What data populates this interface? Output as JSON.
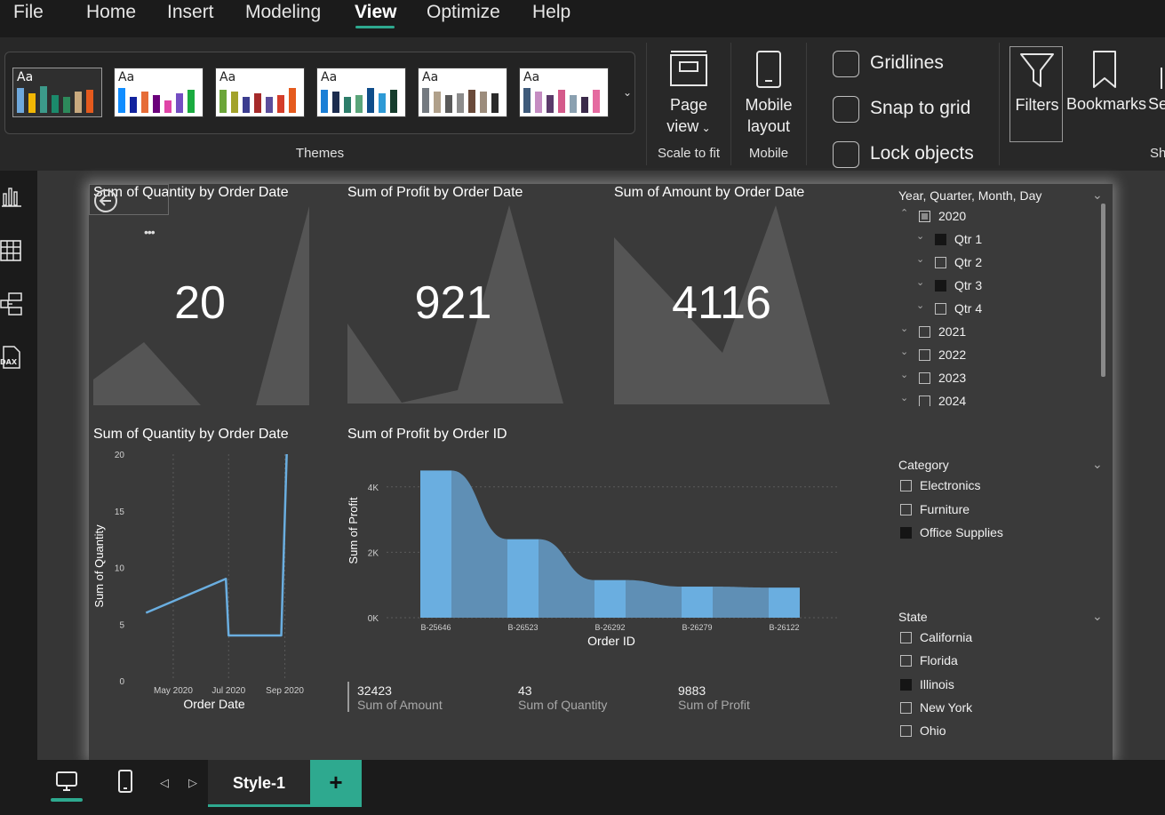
{
  "menubar": {
    "items": [
      "File",
      "Home",
      "Insert",
      "Modeling",
      "View",
      "Optimize",
      "Help"
    ],
    "active": "View"
  },
  "ribbon": {
    "themes_label": "Themes",
    "themes": [
      {
        "aa": "Aa",
        "colors": [
          "#6ea8dc",
          "#f2b705",
          "#3c9a8a",
          "#1b8a6b",
          "#2d8a5b",
          "#c8a97e",
          "#e55a1d"
        ]
      },
      {
        "aa": "Aa",
        "colors": [
          "#118dff",
          "#12239e",
          "#e66c37",
          "#6b007b",
          "#e044a7",
          "#744ec2",
          "#1aab40"
        ]
      },
      {
        "aa": "Aa",
        "colors": [
          "#6ba539",
          "#a2a22b",
          "#3c3d8f",
          "#a52a2a",
          "#5b4d9b",
          "#d43d2a",
          "#e55a1d"
        ]
      },
      {
        "aa": "Aa",
        "colors": [
          "#1b7fd6",
          "#1c2c4e",
          "#2d7d6a",
          "#5aa57a",
          "#0f4d8a",
          "#2e9ad6",
          "#163d2d"
        ]
      },
      {
        "aa": "Aa",
        "colors": [
          "#747a80",
          "#b0a08a",
          "#5a5a5a",
          "#8c8c8c",
          "#6a4a3a",
          "#9c8c7c",
          "#2a2a2a"
        ]
      },
      {
        "aa": "Aa",
        "colors": [
          "#3e5a7a",
          "#c58cc2",
          "#5a3a6a",
          "#d45a8a",
          "#8aa0b0",
          "#3a2a4a",
          "#e56aa0"
        ]
      }
    ],
    "page_view": {
      "line1": "Page",
      "line2": "view",
      "group": "Scale to fit"
    },
    "mobile_layout": {
      "line1": "Mobile",
      "line2": "layout",
      "group": "Mobile"
    },
    "checkboxes": [
      "Gridlines",
      "Snap to grid",
      "Lock objects"
    ],
    "filters": "Filters",
    "bookmarks": "Bookmarks",
    "selection_partial": "Se",
    "show_partial": "Sh"
  },
  "cards": [
    {
      "title": "Sum of Quantity by Order Date",
      "value": "20"
    },
    {
      "title": "Sum of Profit by Order Date",
      "value": "921"
    },
    {
      "title": "Sum of Amount by Order Date",
      "value": "4116"
    }
  ],
  "line_chart": {
    "title": "Sum of Quantity by Order Date",
    "xlabel": "Order Date",
    "ylabel": "Sum of Quantity",
    "yticks": [
      "0",
      "5",
      "10",
      "15",
      "20"
    ],
    "xticks": [
      "May 2020",
      "Jul 2020",
      "Sep 2020"
    ]
  },
  "ribbon_chart": {
    "title": "Sum of Profit by Order ID",
    "xlabel": "Order ID",
    "ylabel": "Sum of Profit",
    "yticks": [
      "0K",
      "2K",
      "4K"
    ]
  },
  "chart_data": [
    {
      "type": "line",
      "title": "Sum of Quantity by Order Date",
      "xlabel": "Order Date",
      "ylabel": "Sum of Quantity",
      "x": [
        "2020-04-01",
        "2020-06-28",
        "2020-07-01",
        "2020-08-01",
        "2020-08-28",
        "2020-09-03"
      ],
      "y": [
        6,
        9,
        4,
        4,
        4,
        20
      ],
      "ylim": [
        0,
        20
      ],
      "xticks": [
        "May 2020",
        "Jul 2020",
        "Sep 2020"
      ],
      "color": "#6aaee0"
    },
    {
      "type": "bar",
      "title": "Sum of Profit by Order ID",
      "xlabel": "Order ID",
      "ylabel": "Sum of Profit",
      "categories": [
        "B-25646",
        "B-26523",
        "B-26292",
        "B-26279",
        "B-26122"
      ],
      "values": [
        4500,
        2400,
        1150,
        950,
        920
      ],
      "ylim": [
        0,
        5000
      ],
      "yticks": [
        "0K",
        "2K",
        "4K"
      ],
      "color": "#6aaee0"
    }
  ],
  "kpis": [
    {
      "value": "32423",
      "label": "Sum of Amount"
    },
    {
      "value": "43",
      "label": "Sum of Quantity"
    },
    {
      "value": "9883",
      "label": "Sum of Profit"
    }
  ],
  "date_slicer": {
    "title": "Year, Quarter, Month, Day",
    "items": [
      {
        "label": "2020",
        "state": "partial",
        "level": 0,
        "expanded": true
      },
      {
        "label": "Qtr 1",
        "state": "filled",
        "level": 1
      },
      {
        "label": "Qtr 2",
        "state": "empty",
        "level": 1
      },
      {
        "label": "Qtr 3",
        "state": "filled",
        "level": 1
      },
      {
        "label": "Qtr 4",
        "state": "empty",
        "level": 1
      },
      {
        "label": "2021",
        "state": "empty",
        "level": 0
      },
      {
        "label": "2022",
        "state": "empty",
        "level": 0
      },
      {
        "label": "2023",
        "state": "empty",
        "level": 0
      },
      {
        "label": "2024",
        "state": "empty",
        "level": 0
      }
    ]
  },
  "category_slicer": {
    "title": "Category",
    "items": [
      {
        "label": "Electronics",
        "state": "empty"
      },
      {
        "label": "Furniture",
        "state": "empty"
      },
      {
        "label": "Office Supplies",
        "state": "filled"
      }
    ]
  },
  "state_slicer": {
    "title": "State",
    "items": [
      {
        "label": "California",
        "state": "empty"
      },
      {
        "label": "Florida",
        "state": "empty"
      },
      {
        "label": "Illinois",
        "state": "filled"
      },
      {
        "label": "New York",
        "state": "empty"
      },
      {
        "label": "Ohio",
        "state": "empty"
      }
    ]
  },
  "pages": {
    "active": "Style-1",
    "add": "+"
  }
}
